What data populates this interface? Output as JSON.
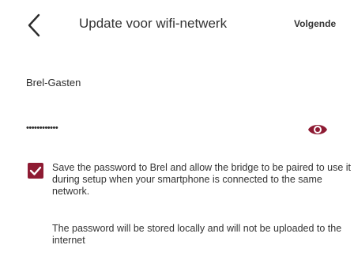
{
  "header": {
    "back_icon": "chevron-left-icon",
    "title": "Update voor wifi-netwerk",
    "next_label": "Volgende"
  },
  "form": {
    "ssid_value": "Brel-Gasten",
    "password_masked": "••••••••••••",
    "visibility_icon": "eye-icon",
    "save_password_checked": true,
    "save_password_label": "Save the password to Brel and allow the bridge to be paired to use it during setup when your smartphone is connected to the same network.",
    "storage_note": "The password will be stored locally and will not be uploaded to the internet"
  },
  "colors": {
    "accent": "#8e1b33",
    "text": "#333333",
    "background": "#ffffff"
  }
}
